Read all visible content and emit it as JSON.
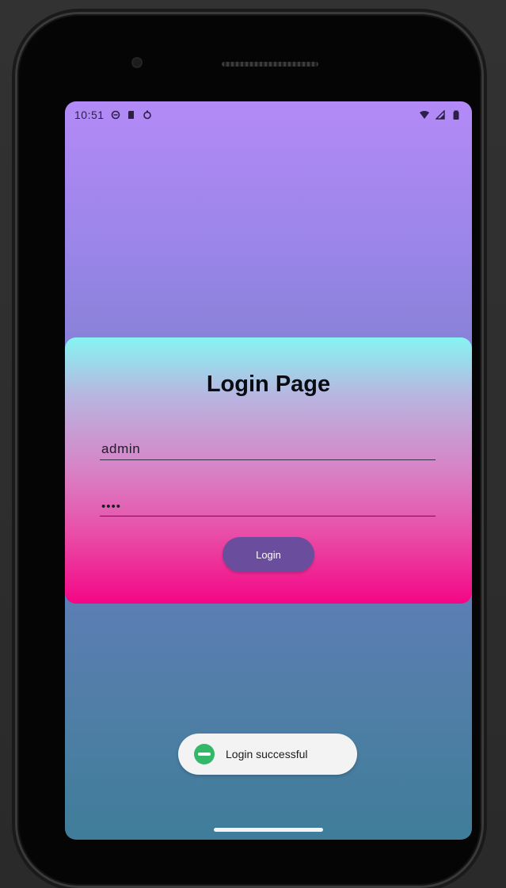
{
  "status_bar": {
    "time": "10:51",
    "left_icons": [
      "do-not-disturb-icon",
      "sd-card-icon",
      "sync-icon"
    ],
    "right_icons": [
      "wifi-icon",
      "cell-signal-icon",
      "battery-icon"
    ]
  },
  "login_card": {
    "title": "Login Page",
    "username_value": "admin",
    "password_value": "••••",
    "login_button_label": "Login"
  },
  "toast": {
    "message": "Login successful",
    "icon": "app-icon"
  },
  "colors": {
    "background_top": "#b38af7",
    "background_bottom": "#3f7d9a",
    "card_top": "#86f4f2",
    "card_bottom": "#f40685",
    "button": "#6a4d9d",
    "toast_icon": "#33b769"
  }
}
